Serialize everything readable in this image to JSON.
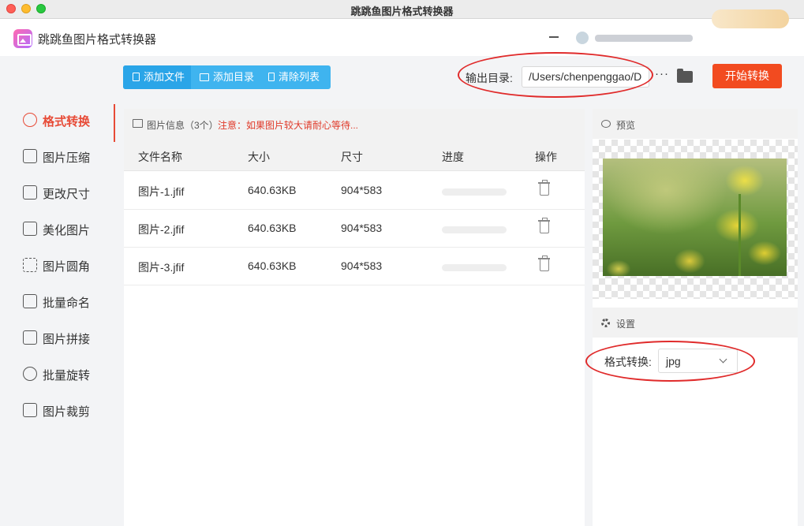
{
  "window": {
    "title": "跳跳鱼图片格式转换器"
  },
  "app": {
    "name": "跳跳鱼图片格式转换器"
  },
  "sidebar": {
    "items": [
      {
        "label": "格式转换",
        "icon": "format-convert-icon",
        "active": true
      },
      {
        "label": "图片压缩",
        "icon": "compress-icon",
        "active": false
      },
      {
        "label": "更改尺寸",
        "icon": "resize-icon",
        "active": false
      },
      {
        "label": "美化图片",
        "icon": "beautify-icon",
        "active": false
      },
      {
        "label": "图片圆角",
        "icon": "rounded-corner-icon",
        "active": false
      },
      {
        "label": "批量命名",
        "icon": "rename-icon",
        "active": false
      },
      {
        "label": "图片拼接",
        "icon": "stitch-icon",
        "active": false
      },
      {
        "label": "批量旋转",
        "icon": "rotate-icon",
        "active": false
      },
      {
        "label": "图片裁剪",
        "icon": "crop-icon",
        "active": false
      }
    ]
  },
  "toolbar": {
    "add_file": "添加文件",
    "add_dir": "添加目录",
    "clear_list": "清除列表",
    "output_label": "输出目录:",
    "output_path": "/Users/chenpenggao/D",
    "more": "···",
    "start": "开始转换"
  },
  "file_panel": {
    "title": "图片信息（3个）",
    "note": "注意：如果图片较大请耐心等待...",
    "columns": [
      "文件名称",
      "大小",
      "尺寸",
      "进度",
      "操作"
    ],
    "rows": [
      {
        "name": "图片-1.jfif",
        "size": "640.63KB",
        "dims": "904*583",
        "progress": 0
      },
      {
        "name": "图片-2.jfif",
        "size": "640.63KB",
        "dims": "904*583",
        "progress": 0
      },
      {
        "name": "图片-3.jfif",
        "size": "640.63KB",
        "dims": "904*583",
        "progress": 0
      }
    ]
  },
  "preview": {
    "title": "预览"
  },
  "settings": {
    "title": "设置",
    "format_label": "格式转换:",
    "format_value": "jpg"
  },
  "colors": {
    "accent": "#e74a36",
    "primary_blue": "#3fb4ef",
    "start_button": "#f24b20",
    "annotation": "#e02b2b"
  }
}
